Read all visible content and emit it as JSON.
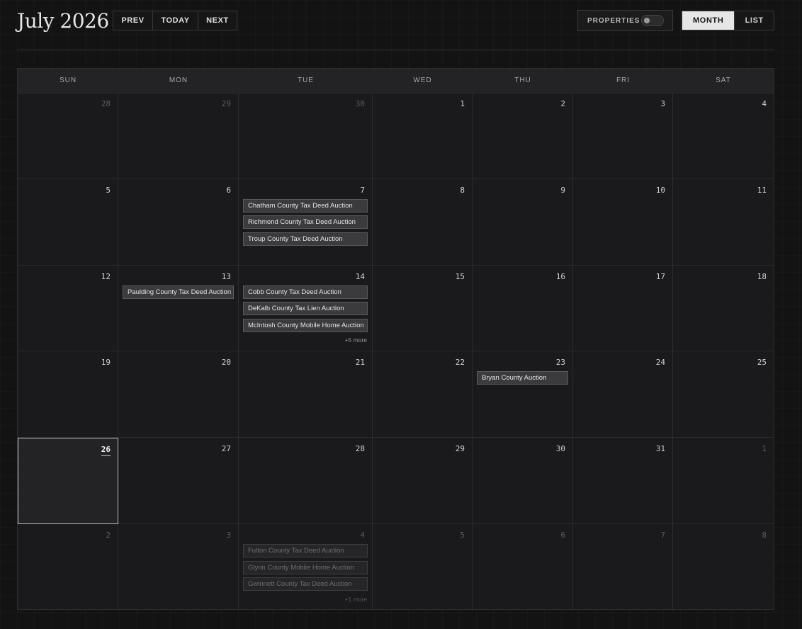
{
  "header": {
    "title": "July 2026",
    "nav": {
      "prev": "PREV",
      "today": "TODAY",
      "next": "NEXT"
    },
    "properties_label": "PROPERTIES",
    "properties_toggle_on": false,
    "views": {
      "month": "MONTH",
      "list": "LIST",
      "active": "month"
    }
  },
  "weekdays": [
    "SUN",
    "MON",
    "TUE",
    "WED",
    "THU",
    "FRI",
    "SAT"
  ],
  "weeks": [
    [
      {
        "day": "28",
        "other": true,
        "events": []
      },
      {
        "day": "29",
        "other": true,
        "events": []
      },
      {
        "day": "30",
        "other": true,
        "events": []
      },
      {
        "day": "1",
        "events": []
      },
      {
        "day": "2",
        "events": []
      },
      {
        "day": "3",
        "events": []
      },
      {
        "day": "4",
        "events": []
      }
    ],
    [
      {
        "day": "5",
        "events": []
      },
      {
        "day": "6",
        "events": []
      },
      {
        "day": "7",
        "events": [
          "Chatham County Tax Deed Auction",
          "Richmond County Tax Deed Auction",
          "Troup County Tax Deed Auction"
        ]
      },
      {
        "day": "8",
        "events": []
      },
      {
        "day": "9",
        "events": []
      },
      {
        "day": "10",
        "events": []
      },
      {
        "day": "11",
        "events": []
      }
    ],
    [
      {
        "day": "12",
        "events": []
      },
      {
        "day": "13",
        "events": [
          "Paulding County Tax Deed Auction"
        ]
      },
      {
        "day": "14",
        "events": [
          "Cobb County Tax Deed Auction",
          "DeKalb County Tax Lien Auction",
          "McIntosh County Mobile Home Auction"
        ],
        "more": "+5 more"
      },
      {
        "day": "15",
        "events": []
      },
      {
        "day": "16",
        "events": []
      },
      {
        "day": "17",
        "events": []
      },
      {
        "day": "18",
        "events": []
      }
    ],
    [
      {
        "day": "19",
        "events": []
      },
      {
        "day": "20",
        "events": []
      },
      {
        "day": "21",
        "events": []
      },
      {
        "day": "22",
        "events": []
      },
      {
        "day": "23",
        "events": [
          "Bryan County Auction"
        ]
      },
      {
        "day": "24",
        "events": []
      },
      {
        "day": "25",
        "events": []
      }
    ],
    [
      {
        "day": "26",
        "today": true,
        "events": []
      },
      {
        "day": "27",
        "events": []
      },
      {
        "day": "28",
        "events": []
      },
      {
        "day": "29",
        "events": []
      },
      {
        "day": "30",
        "events": []
      },
      {
        "day": "31",
        "events": []
      },
      {
        "day": "1",
        "other": true,
        "events": []
      }
    ],
    [
      {
        "day": "2",
        "other": true,
        "events": []
      },
      {
        "day": "3",
        "other": true,
        "events": []
      },
      {
        "day": "4",
        "other": true,
        "events": [
          "Fulton County Tax Deed Auction",
          "Glynn County Mobile Home Auction",
          "Gwinnett County Tax Deed Auction"
        ],
        "more": "+1 more"
      },
      {
        "day": "5",
        "other": true,
        "events": []
      },
      {
        "day": "6",
        "other": true,
        "events": []
      },
      {
        "day": "7",
        "other": true,
        "events": []
      },
      {
        "day": "8",
        "other": true,
        "events": []
      }
    ]
  ]
}
